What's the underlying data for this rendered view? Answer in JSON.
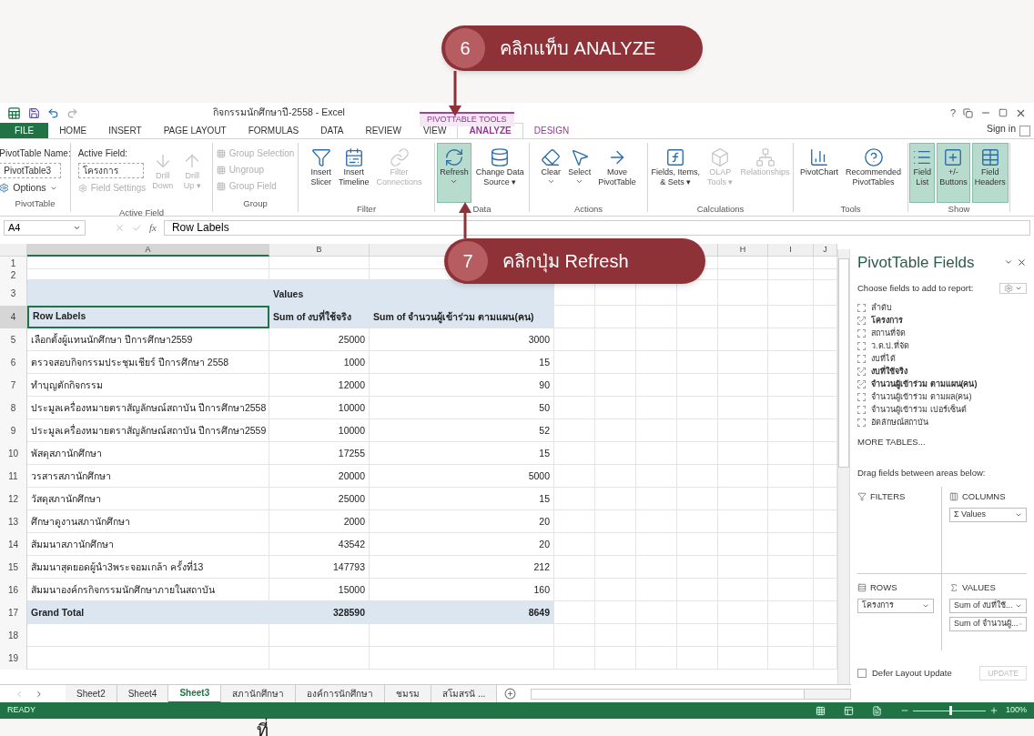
{
  "callouts": [
    {
      "number": "6",
      "text": "คลิกแท็บ ANALYZE"
    },
    {
      "number": "7",
      "text": "คลิกปุ่ม Refresh"
    }
  ],
  "window": {
    "title": "กิจกรรมนักศึกษาปี-2558 - Excel",
    "sign_in": "Sign in",
    "help": "?"
  },
  "contextual_label": "PIVOTTABLE TOOLS",
  "tabs": [
    {
      "label": "FILE",
      "kind": "file",
      "selected": false
    },
    {
      "label": "HOME",
      "kind": "tab",
      "selected": false
    },
    {
      "label": "INSERT",
      "kind": "tab",
      "selected": false
    },
    {
      "label": "PAGE LAYOUT",
      "kind": "tab",
      "selected": false
    },
    {
      "label": "FORMULAS",
      "kind": "tab",
      "selected": false
    },
    {
      "label": "DATA",
      "kind": "tab",
      "selected": false
    },
    {
      "label": "REVIEW",
      "kind": "tab",
      "selected": false
    },
    {
      "label": "VIEW",
      "kind": "tab",
      "selected": false
    },
    {
      "label": "ANALYZE",
      "kind": "context",
      "selected": true
    },
    {
      "label": "DESIGN",
      "kind": "context",
      "selected": false
    }
  ],
  "ribbon_groups": [
    {
      "kind": "pivot_name",
      "title": "PivotTable",
      "label": "PivotTable Name:",
      "value": "PivotTable3",
      "button": "Options"
    },
    {
      "kind": "active_field",
      "title": "Active Field",
      "label": "Active Field:",
      "value": "โครงการ",
      "settings": {
        "label": "Field Settings",
        "disabled": true
      },
      "buttons": [
        {
          "lines": [
            "Drill",
            "Down"
          ],
          "disabled": true,
          "dropdown": false,
          "selected": false
        },
        {
          "lines": [
            "Drill",
            "Up ▾"
          ],
          "disabled": true,
          "dropdown": false,
          "selected": false
        }
      ]
    },
    {
      "kind": "small",
      "title": "Group",
      "buttons": [
        {
          "label": "Group Selection",
          "disabled": true
        },
        {
          "label": "Ungroup",
          "disabled": true
        },
        {
          "label": "Group Field",
          "disabled": true
        }
      ]
    },
    {
      "kind": "large",
      "title": "Filter",
      "buttons": [
        {
          "lines": [
            "Insert",
            "Slicer"
          ],
          "disabled": false,
          "dropdown": false,
          "selected": false
        },
        {
          "lines": [
            "Insert",
            "Timeline"
          ],
          "disabled": false,
          "dropdown": false,
          "selected": false
        },
        {
          "lines": [
            "Filter",
            "Connections"
          ],
          "disabled": true,
          "dropdown": false,
          "selected": false
        }
      ]
    },
    {
      "kind": "large",
      "title": "Data",
      "buttons": [
        {
          "lines": [
            "Refresh"
          ],
          "disabled": false,
          "dropdown": true,
          "selected": true
        },
        {
          "lines": [
            "Change Data",
            "Source ▾"
          ],
          "disabled": false,
          "dropdown": false,
          "selected": false
        }
      ]
    },
    {
      "kind": "large",
      "title": "Actions",
      "buttons": [
        {
          "lines": [
            "Clear"
          ],
          "disabled": false,
          "dropdown": true,
          "selected": false
        },
        {
          "lines": [
            "Select"
          ],
          "disabled": false,
          "dropdown": true,
          "selected": false
        },
        {
          "lines": [
            "Move",
            "PivotTable"
          ],
          "disabled": false,
          "dropdown": false,
          "selected": false
        }
      ]
    },
    {
      "kind": "large",
      "title": "Calculations",
      "buttons": [
        {
          "lines": [
            "Fields, Items,",
            "& Sets ▾"
          ],
          "disabled": false,
          "dropdown": false,
          "selected": false
        },
        {
          "lines": [
            "OLAP",
            "Tools ▾"
          ],
          "disabled": true,
          "dropdown": false,
          "selected": false
        },
        {
          "lines": [
            "Relationships"
          ],
          "disabled": true,
          "dropdown": false,
          "selected": false
        }
      ]
    },
    {
      "kind": "large",
      "title": "Tools",
      "buttons": [
        {
          "lines": [
            "PivotChart"
          ],
          "disabled": false,
          "dropdown": false,
          "selected": false
        },
        {
          "lines": [
            "Recommended",
            "PivotTables"
          ],
          "disabled": false,
          "dropdown": false,
          "selected": false
        }
      ]
    },
    {
      "kind": "large",
      "title": "Show",
      "buttons": [
        {
          "lines": [
            "Field",
            "List"
          ],
          "disabled": false,
          "dropdown": false,
          "selected": true
        },
        {
          "lines": [
            "+/-",
            "Buttons"
          ],
          "disabled": false,
          "dropdown": false,
          "selected": true
        },
        {
          "lines": [
            "Field",
            "Headers"
          ],
          "disabled": false,
          "dropdown": false,
          "selected": true
        }
      ]
    }
  ],
  "formula_bar": {
    "name_box": "A4",
    "fx": "fx",
    "value": "Row Labels"
  },
  "sheet": {
    "column_headers": [
      "A",
      "B",
      "H",
      "I",
      "J"
    ],
    "values_label": "Values",
    "header": [
      "Row Labels",
      "Sum of งบที่ใช้จริง",
      "Sum of จำนวนผู้เข้าร่วม ตามแผน(คน)"
    ],
    "rows": [
      [
        "เลือกตั้งผู้แทนนักศึกษา ปีการศึกษา2559",
        "25000",
        "3000"
      ],
      [
        "ตรวจสอบกิจกรรมประชุมเชียร์ ปีการศึกษา 2558",
        "1000",
        "15"
      ],
      [
        "ทำบุญตักกิจกรรม",
        "12000",
        "90"
      ],
      [
        "ประมูลเครื่องหมายตราสัญลักษณ์สถาบัน ปีการศึกษา2558",
        "10000",
        "50"
      ],
      [
        "ประมูลเครื่องหมายตราสัญลักษณ์สถาบัน ปีการศึกษา2559",
        "10000",
        "52"
      ],
      [
        "พัสดุสภานักศึกษา",
        "17255",
        "15"
      ],
      [
        "วรสารสภานักศึกษา",
        "20000",
        "5000"
      ],
      [
        "วัสดุสภานักศึกษา",
        "25000",
        "15"
      ],
      [
        "ศึกษาดูงานสภานักศึกษา",
        "2000",
        "20"
      ],
      [
        "สัมมนาสภานักศึกษา",
        "43542",
        "20"
      ],
      [
        "สัมมนาสุดยอดผู้นำ3พระจอมเกล้า ครั้งที่13",
        "147793",
        "212"
      ],
      [
        "สัมมนาองค์กรกิจกรรมนักศึกษาภายในสถาบัน",
        "15000",
        "160"
      ]
    ],
    "total": [
      "Grand Total",
      "328590",
      "8649"
    ],
    "row_numbers": [
      "1",
      "2",
      "3",
      "4",
      "5",
      "6",
      "7",
      "8",
      "9",
      "10",
      "11",
      "12",
      "13",
      "14",
      "15",
      "16",
      "17",
      "18",
      "19"
    ]
  },
  "sheet_tabs": [
    {
      "label": "Sheet2",
      "selected": false
    },
    {
      "label": "Sheet4",
      "selected": false
    },
    {
      "label": "Sheet3",
      "selected": true
    },
    {
      "label": "สภานักศึกษา",
      "selected": false
    },
    {
      "label": "องค์การนักศึกษา",
      "selected": false
    },
    {
      "label": "ชมรม",
      "selected": false
    },
    {
      "label": "สโมสรนั ...",
      "selected": false
    }
  ],
  "task_pane": {
    "title": "PivotTable Fields",
    "prompt": "Choose fields to add to report:",
    "fields": [
      {
        "label": "ลำดับ",
        "checked": false
      },
      {
        "label": "โครงการ",
        "checked": true
      },
      {
        "label": "สถานที่จัด",
        "checked": false
      },
      {
        "label": "ว.ด.ป.ที่จัด",
        "checked": false
      },
      {
        "label": "งบที่ได้",
        "checked": false
      },
      {
        "label": "งบที่ใช้จริง",
        "checked": true
      },
      {
        "label": "จำนวนผู้เข้าร่วม ตามแผน(คน)",
        "checked": true
      },
      {
        "label": "จำนวนผู้เข้าร่วม ตามผล(คน)",
        "checked": false
      },
      {
        "label": "จำนวนผู้เข้าร่วม เปอร์เซ็นต์",
        "checked": false
      },
      {
        "label": "อัตลักษณ์สถาบัน",
        "checked": false
      }
    ],
    "more_tables": "MORE TABLES...",
    "drag_hint": "Drag fields between areas below:",
    "areas": [
      {
        "kind": "filters",
        "title": "FILTERS"
      },
      {
        "kind": "columns",
        "title": "COLUMNS",
        "items": [
          "Σ Values"
        ]
      },
      {
        "kind": "rows",
        "title": "ROWS",
        "items": [
          "โครงการ"
        ]
      },
      {
        "kind": "values",
        "title": "VALUES",
        "items": [
          "Sum of งบที่ใช้...",
          "Sum of จำนวนผู้..."
        ]
      }
    ],
    "defer": {
      "label": "Defer Layout Update",
      "checked": false
    },
    "update": {
      "label": "UPDATE",
      "disabled": true
    }
  },
  "status_bar": {
    "text": "READY",
    "zoom": "100%",
    "level": 0.5
  },
  "caption": "ที่"
}
